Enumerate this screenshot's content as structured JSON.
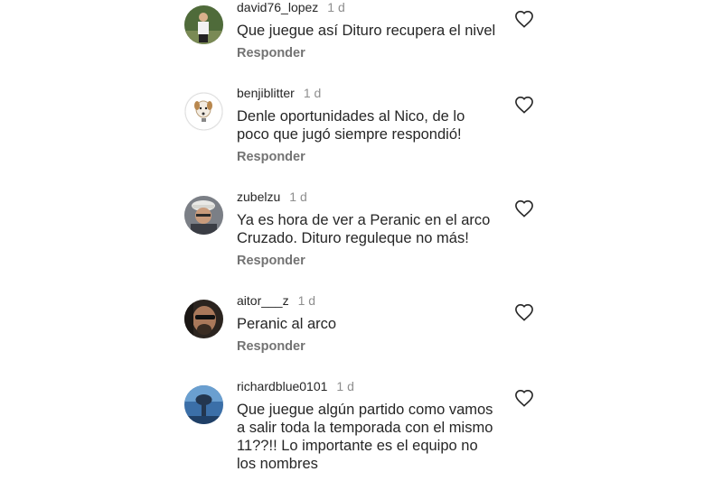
{
  "comments": [
    {
      "username": "david76_lopez",
      "time": "1 d",
      "text": "Que juegue así Dituro recupera el nivel",
      "reply_label": "Responder"
    },
    {
      "username": "benjiblitter",
      "time": "1 d",
      "text": "Denle oportunidades al Nico, de lo\npoco que jugó siempre respondió!",
      "reply_label": "Responder"
    },
    {
      "username": "zubelzu",
      "time": "1 d",
      "text": "Ya es hora de ver a Peranic en el arco\nCruzado. Dituro reguleque no más!",
      "reply_label": "Responder"
    },
    {
      "username": "aitor___z",
      "time": "1 d",
      "text": "Peranic al arco",
      "reply_label": "Responder"
    },
    {
      "username": "richardblue0101",
      "time": "1 d",
      "text": "Que juegue algún partido como vamos\na salir toda la temporada con el mismo\n11??!! Lo importante es el equipo no\nlos nombres",
      "reply_label": ""
    }
  ],
  "icons": {
    "like": "heart-outline-icon",
    "avatar": "user-avatar"
  },
  "colors": {
    "text": "#262626",
    "secondary": "#8e8e8e",
    "reply": "#737373",
    "background": "#ffffff"
  }
}
